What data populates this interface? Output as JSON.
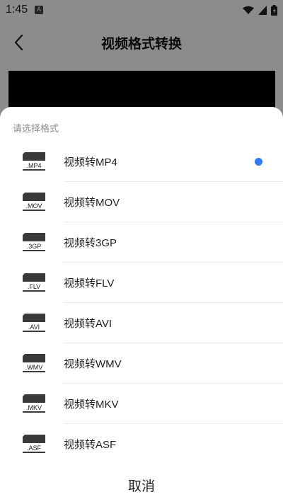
{
  "status_bar": {
    "time": "1:45",
    "app_icon_letter": "A",
    "icons": [
      "wifi-icon",
      "signal-icon",
      "battery-icon"
    ]
  },
  "header": {
    "title": "视频格式转换",
    "back_icon": "chevron-left-icon"
  },
  "sheet": {
    "title": "请选择格式",
    "options": [
      {
        "label": "视频转MP4",
        "badge": ".MP4",
        "selected": true
      },
      {
        "label": "视频转MOV",
        "badge": ".MOV",
        "selected": false
      },
      {
        "label": "视频转3GP",
        "badge": ".3GP",
        "selected": false
      },
      {
        "label": "视频转FLV",
        "badge": ".FLV",
        "selected": false
      },
      {
        "label": "视频转AVI",
        "badge": ".AVI",
        "selected": false
      },
      {
        "label": "视频转WMV",
        "badge": ".WMV",
        "selected": false
      },
      {
        "label": "视频转MKV",
        "badge": ".MKV",
        "selected": false
      },
      {
        "label": "视频转ASF",
        "badge": ".ASF",
        "selected": false
      }
    ],
    "cancel_label": "取消"
  },
  "colors": {
    "accent": "#2f7bf5",
    "overlay": "rgba(0,0,0,0.45)",
    "text": "#222222",
    "muted": "#8a8a8a"
  }
}
